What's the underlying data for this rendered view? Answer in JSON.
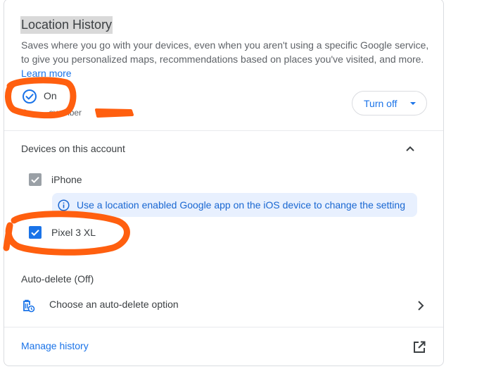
{
  "section": {
    "title": "Location History",
    "description": "Saves where you go with your devices, even when you aren't using a specific Google service, to give you personalized maps, recommendations based on places you've visited, and more.",
    "learn_more": "Learn more"
  },
  "status": {
    "label": "On",
    "sub_visible": "On       ovember",
    "turn_off_label": "Turn off"
  },
  "devices": {
    "header": "Devices on this account",
    "items": [
      {
        "label": "iPhone",
        "checked": true,
        "disabled": true
      },
      {
        "label": "Pixel 3 XL",
        "checked": true,
        "disabled": false
      }
    ],
    "info_banner": "Use a location enabled Google app on the iOS device to change the setting"
  },
  "auto_delete": {
    "header": "Auto-delete (Off)",
    "option_label": "Choose an auto-delete option"
  },
  "footer": {
    "manage_label": "Manage history"
  },
  "icons": {
    "status": "check-circle-icon",
    "collapse": "chevron-up-icon",
    "info": "info-icon",
    "auto_delete": "trash-clock-icon",
    "row_chevron": "chevron-right-icon",
    "open": "open-in-new-icon"
  },
  "colors": {
    "accent": "#1a73e8",
    "annotation": "#ff5f0f",
    "banner_bg": "#e8f0fe",
    "disabled_checkbox": "#9aa0a6",
    "title_highlight": "#d9d9d9"
  }
}
